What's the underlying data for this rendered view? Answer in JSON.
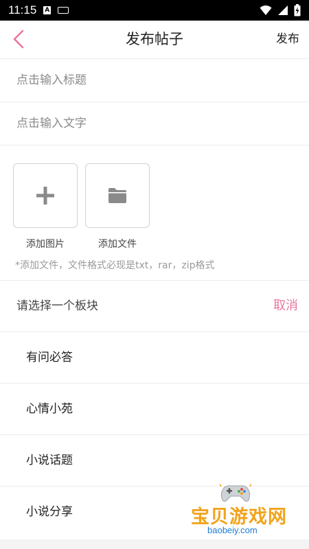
{
  "status_bar": {
    "time": "11:15",
    "icons": [
      "a-notification-icon",
      "keyboard-icon",
      "wifi-icon",
      "signal-icon",
      "battery-charging-icon"
    ]
  },
  "header": {
    "title": "发布帖子",
    "publish_label": "发布",
    "back_icon": "chevron-left-icon",
    "accent_color": "#e9779d"
  },
  "form": {
    "title_placeholder": "点击输入标题",
    "content_placeholder": "点击输入文字"
  },
  "attachments": {
    "add_image_label": "添加图片",
    "add_file_label": "添加文件",
    "hint": "*添加文件，文件格式必现是txt，rar，zip格式"
  },
  "board_select": {
    "prompt": "请选择一个板块",
    "cancel_label": "取消",
    "sections": [
      {
        "label": "有问必答"
      },
      {
        "label": "心情小苑"
      },
      {
        "label": "小说话题"
      },
      {
        "label": "小说分享"
      }
    ]
  },
  "watermark": {
    "text": "宝贝游戏网",
    "url": "baobeiy.com"
  }
}
